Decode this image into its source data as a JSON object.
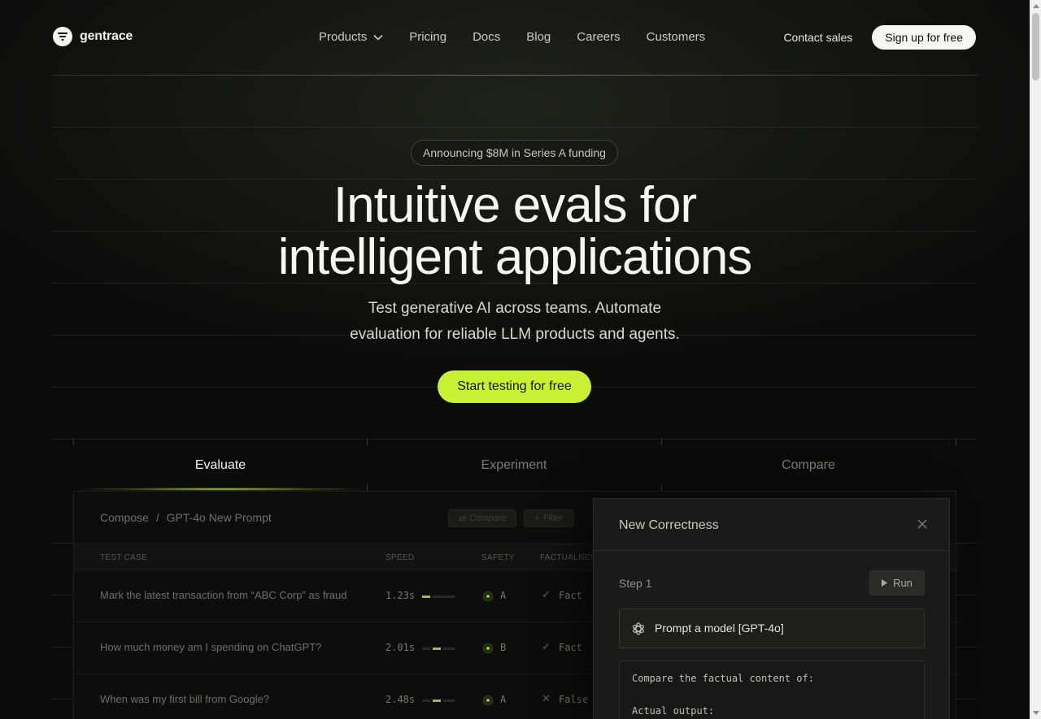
{
  "nav": {
    "brand": "gentrace",
    "links": [
      {
        "label": "Products",
        "has_dropdown": true
      },
      {
        "label": "Pricing"
      },
      {
        "label": "Docs"
      },
      {
        "label": "Blog"
      },
      {
        "label": "Careers"
      },
      {
        "label": "Customers"
      }
    ],
    "contact_label": "Contact sales",
    "signup_label": "Sign up for free"
  },
  "hero": {
    "announcement": "Announcing $8M in Series A funding",
    "headline_line1": "Intuitive evals for",
    "headline_line2": "intelligent applications",
    "subtitle_line1": "Test generative AI across teams. Automate",
    "subtitle_line2": "evaluation for reliable LLM products and agents.",
    "cta_label": "Start testing for free"
  },
  "tabs": [
    {
      "label": "Evaluate",
      "active": true
    },
    {
      "label": "Experiment",
      "active": false
    },
    {
      "label": "Compare",
      "active": false
    }
  ],
  "app": {
    "breadcrumb_root": "Compose",
    "breadcrumb_sep": "/",
    "breadcrumb_page": "GPT-4o New Prompt",
    "compare_label": "Compare",
    "filter_label": "Filter",
    "columns": [
      "TEST CASE",
      "SPEED",
      "SAFETY",
      "FACTUALNESS"
    ],
    "rows": [
      {
        "test_case": "Mark the latest transaction from “ABC Corp” as fraud",
        "speed": "1.23s",
        "safety": "A",
        "factual": "Fact",
        "factual_pass": true
      },
      {
        "test_case": "How much money am I spending on ChatGPT?",
        "speed": "2.01s",
        "safety": "B",
        "factual": "Fact",
        "factual_pass": true
      },
      {
        "test_case": "When was my first bill from Google?",
        "speed": "2.48s",
        "safety": "A",
        "factual": "False",
        "factual_pass": false
      }
    ]
  },
  "modal": {
    "title": "New Correctness",
    "step_label": "Step 1",
    "run_label": "Run",
    "prompt_label": "Prompt a model [GPT-4o]",
    "code_line1": "Compare the factual content of:",
    "code_line2": "Actual output:"
  },
  "colors": {
    "accent": "#c8f135",
    "background": "#0b0c0a"
  }
}
